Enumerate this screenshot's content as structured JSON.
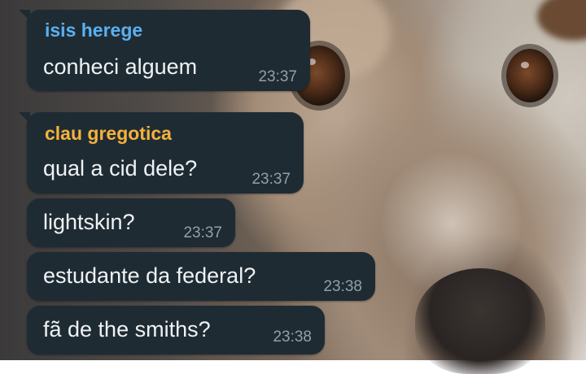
{
  "chat": {
    "messages": [
      {
        "sender": "isis herege",
        "sender_color": "#5ab0f0",
        "text": "conheci alguem",
        "time": "23:37"
      },
      {
        "sender": "clau gregotica",
        "sender_color": "#f4b23c",
        "text": "qual a cid dele?",
        "time": "23:37"
      },
      {
        "sender": "",
        "text": "lightskin?",
        "time": "23:37"
      },
      {
        "sender": "",
        "text": "estudante da federal?",
        "time": "23:38"
      },
      {
        "sender": "",
        "text": "fã de the smiths?",
        "time": "23:38"
      }
    ]
  },
  "colors": {
    "bubble_bg": "#1f2b33",
    "message_text": "#eef2f4",
    "timestamp": "#8fa0aa"
  },
  "wallpaper": {
    "subject": "dog-photo"
  }
}
